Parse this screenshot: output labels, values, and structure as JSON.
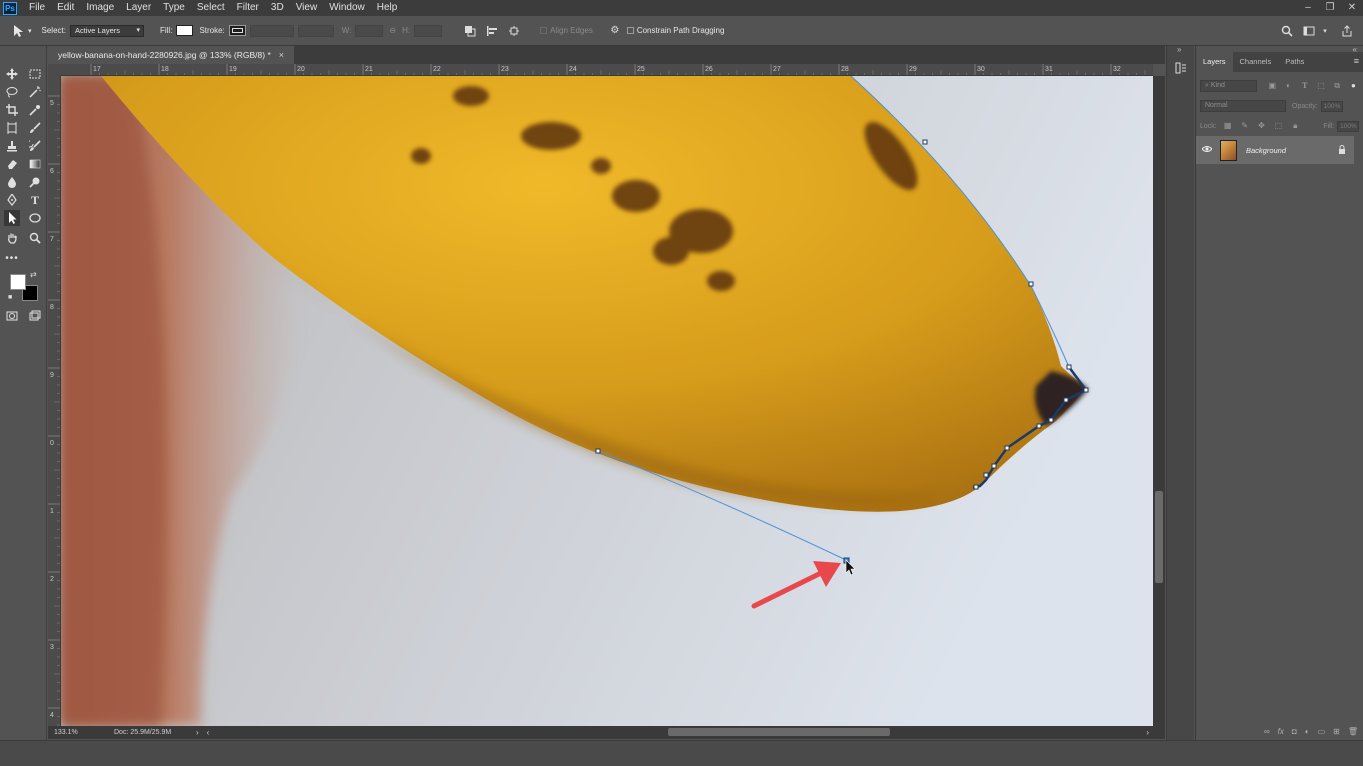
{
  "app": {
    "logo": "Ps",
    "menu": [
      "File",
      "Edit",
      "Image",
      "Layer",
      "Type",
      "Select",
      "Filter",
      "3D",
      "View",
      "Window",
      "Help"
    ],
    "window_controls": [
      "–",
      "❐",
      "✕"
    ]
  },
  "options_bar": {
    "select_label": "Select:",
    "select_value": "Active Layers",
    "fill_label": "Fill:",
    "stroke_label": "Stroke:",
    "w_label": "W:",
    "h_label": "H:",
    "align_edges_label": "Align Edges",
    "constrain_label": "Constrain Path Dragging"
  },
  "document": {
    "tab_title": "yellow-banana-on-hand-2280926.jpg @ 133% (RGB/8) *",
    "close": "×",
    "zoom": "133.1%",
    "doc_info": "Doc: 25.9M/25.9M"
  },
  "rulers": {
    "h_ticks": [
      "17",
      "18",
      "19",
      "20",
      "21",
      "22",
      "23",
      "24",
      "25",
      "26",
      "27",
      "28",
      "29",
      "30",
      "31",
      "32"
    ],
    "v_ticks": [
      "5",
      "6",
      "7",
      "8",
      "9",
      "0",
      "1",
      "2",
      "3",
      "4"
    ]
  },
  "layers_panel": {
    "tabs": [
      "Layers",
      "Channels",
      "Paths"
    ],
    "kind_placeholder": "Kind",
    "blend_mode": "Normal",
    "opacity_label": "Opacity:",
    "opacity_value": "100%",
    "lock_label": "Lock:",
    "fill_label": "Fill:",
    "fill_value": "100%",
    "layer": {
      "name": "Background"
    }
  },
  "colors": {
    "accent": "#31a8ff",
    "path_line": "#4a90d9",
    "arrow": "#e8474b",
    "banana": "#d59a1a"
  }
}
